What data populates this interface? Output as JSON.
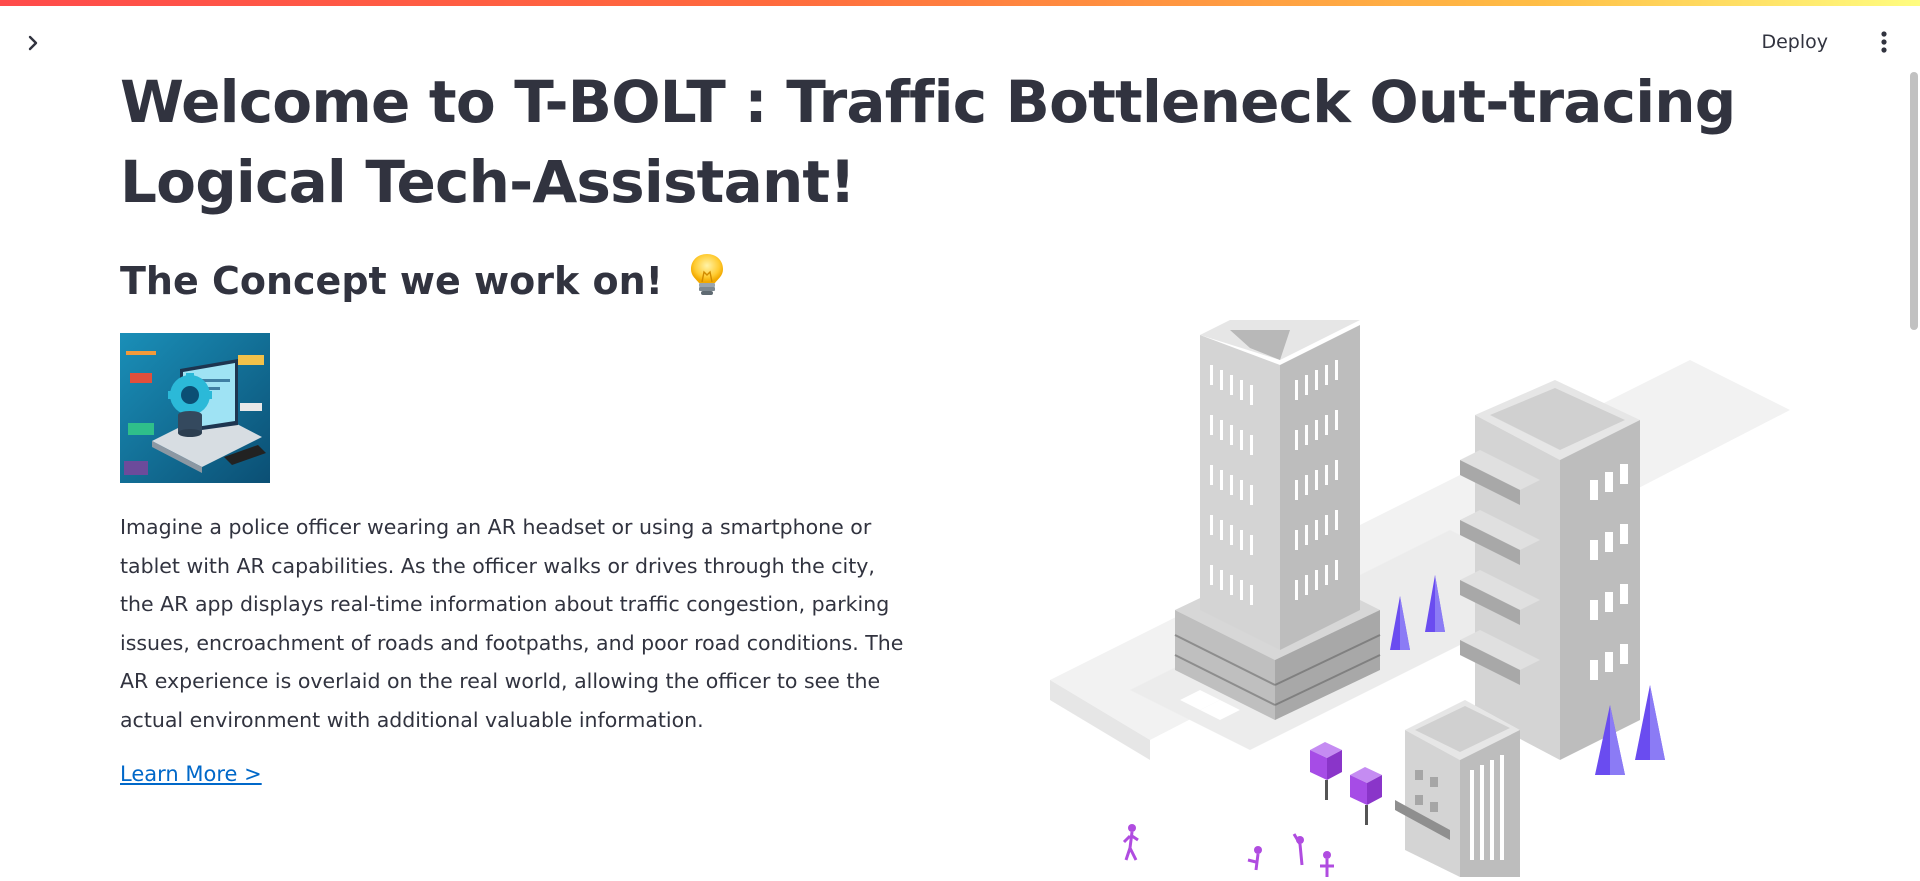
{
  "header": {
    "deploy_label": "Deploy"
  },
  "main": {
    "title": "Welcome to T-BOLT : Traffic Bottleneck Out-tracing Logical Tech-Assistant!",
    "subtitle": "The Concept we work on!",
    "paragraph": "Imagine a police officer wearing an AR headset or using a smartphone or tablet with AR capabilities. As the officer walks or drives through the city, the AR app displays real-time information about traffic congestion, parking issues, encroachment of roads and footpaths, and poor road conditions. The AR experience is overlaid on the real world, allowing the officer to see the actual environment with additional valuable information.",
    "learn_more_label": "Learn More >"
  },
  "icons": {
    "sidebar_toggle": "chevron-right-icon",
    "menu": "more-vertical-icon",
    "subtitle_emoji": "lightbulb-icon"
  },
  "colors": {
    "text": "#31333f",
    "link": "#0068c9",
    "accent_gradient": [
      "#ff4b4b",
      "#ffbd45",
      "#fffd80"
    ],
    "tree_purple": "#6a4cf0",
    "people_purple": "#b04ce0"
  }
}
